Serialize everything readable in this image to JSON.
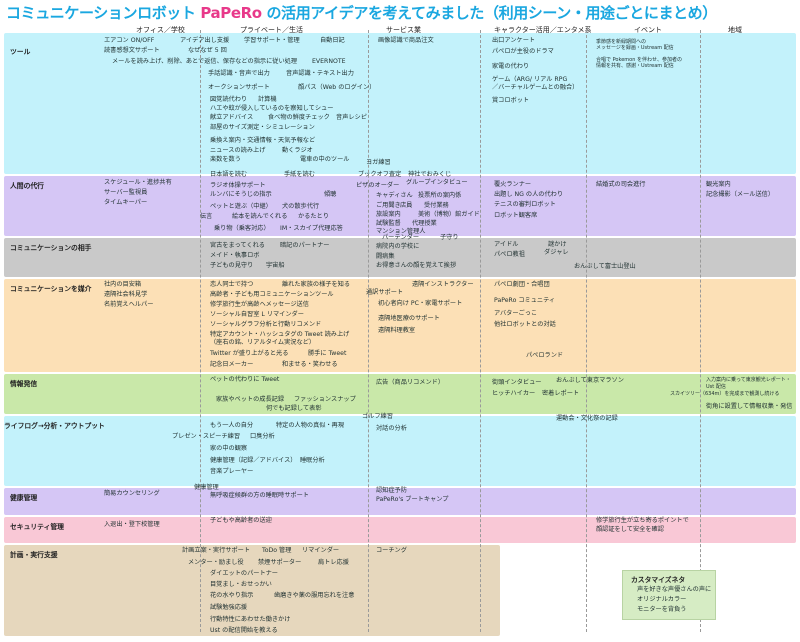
{
  "title_main": "コミュニケーションロボット ",
  "title_brand": "PaPeRo",
  "title_rest": " の活用アイデアを考えてみました（利用シーン・用途ごとにまとめ）",
  "columns": [
    "オフィス／学校",
    "プライベート／生活",
    "サービス業",
    "キャラクター活用／エンタメ系",
    "イベント",
    "地域"
  ],
  "rows": [
    {
      "label": "ツール",
      "color": "#c3f2fb"
    },
    {
      "label": "人間の代行",
      "color": "#d5c6f5"
    },
    {
      "label": "コミュニケーションの相手",
      "color": "#c9c9c9"
    },
    {
      "label": "コミュニケーションを媒介",
      "color": "#fce0b6"
    },
    {
      "label": "情報発信",
      "color": "#c9e8a9"
    },
    {
      "label": "ライフログ→分析・アウトプット",
      "color": "#c3f2fb"
    },
    {
      "label": "健康管理",
      "color": "#d5c6f5"
    },
    {
      "label": "セキュリティ管理",
      "color": "#f9c8d6"
    },
    {
      "label": "計画・実行支援",
      "color": "#e6d7bd"
    }
  ],
  "items": [
    "エアコン ON/OFF",
    "アイデア出し支援",
    "学習サポート・管理",
    "自動日記",
    "画像認識で商品注文",
    "出口アンケート",
    "読書感想文サポート",
    "なぜなぜ 5 回",
    "パペロが主役のドラマ",
    "季節感を新緑期間への",
    "メッセージを録画・Ustream 配信",
    "メールを読み上げ、削除、あとで返信、保存などの指示に従い処理",
    "EVERNOTE",
    "家電の代わり",
    "手話認識・音声で出力",
    "音声認識・テキスト出力",
    "ゲーム（ARG/ リアル RPG",
    "／バーチャルゲームとの融合）",
    "合唱で Pokemon を伴わせ、参加者の",
    "情報を共有、感謝・Ustream 配信",
    "オークションサポート",
    "顔パス（Web のログイン）",
    "賞コロボット",
    "図覚読代わり",
    "計算機",
    "ハエや蚊が侵入しているのを察知してシュー",
    "献立アドバイス",
    "食べ物の鮮度チェック",
    "音声レシピ",
    "部屋のサイズ測定・シミュレーション",
    "乗換え案内・交通情報・天気予報など",
    "ニュースの読み上げ",
    "動くラジオ",
    "楽数を数う",
    "電車の中のツール",
    "ヨガ練習",
    "スケジュール・進捗共有",
    "サーバー監視員",
    "タイムキーパー",
    "日本語を読む",
    "手紙を読む",
    "ブックオフ査定",
    "神社でおみくじ",
    "ラジオ体操サポート",
    "ルンバにそうじの指示",
    "ピザのオーダー",
    "グループインタビュー",
    "覆火ランナー",
    "結婚式の司会進行",
    "観光案内",
    "ペットと遊ぶ（中継）",
    "犬の散歩代行",
    "傾聴",
    "キャディさん",
    "投票所の案内係",
    "出題し NG の人の代わり",
    "記念撮影（メール送信）",
    "絵本を読んでくれる",
    "かるたとり",
    "ご用聞き",
    "店員",
    "受付業務",
    "テニスの審判ロボット",
    "伝言",
    "乗り物（乗客対応）",
    "IM・スカイプ代理応答",
    "旅設案内",
    "美術（博物）館ガイド",
    "ロボット観客席",
    "試験監督",
    "代理授業",
    "マンション管理人",
    "パーテンダー",
    "子守り",
    "宮古をまってくれる",
    "暗記のパートナー",
    "アイドル",
    "謎かけ",
    "メイド・執事ロボ",
    "病院内の学校に",
    "パペロ教祖",
    "ダジャレ",
    "子どもの見守り",
    "宇宙船",
    "闘病集",
    "お得意さんの顔を覚えて挨拶",
    "おんぶして富士山登山",
    "社内の目安箱",
    "恋人同士で持つ",
    "離れた家族の様子を知る",
    "遠隔インストラクター",
    "パペロ劇団・合唱団",
    "遠隔社会科見学",
    "高齢者・子ども用コミュニケーションツール",
    "通訳サポート",
    "名前覚えヘルパー",
    "修学旅行生が高齢ヘメッセージ送信",
    "初心者向け PC・家電サポート",
    "PaPeRo コミュニティ",
    "ソーシャル自習室 L リマインダー",
    "遠隔地医療のサポート",
    "アバターごっこ",
    "ソーシャルグラフ分析と行動リコメンド",
    "他社ロボットとの対話",
    "特定アカウント・ハッシュタグの Tweet 読み上げ",
    "遠隔料理教室",
    "（座右の銘、リアルタイム実況など）",
    "Twitter が盛り上がると光る",
    "勝手に Tweet",
    "パペロランド",
    "記念日メーカー",
    "和ませる・笑わせる",
    "ペットの代わりに Tweet",
    "広告（商品リコメンド）",
    "街頭インタビュー",
    "おんぶして東京マラソン",
    "入力案内に乗って東京観光レポート・",
    "Ust 配信",
    "ヒッチハイカー",
    "密着レポート",
    "スカイツリー（634m）を完成まで観測し続ける",
    "家族やペットの成長記録",
    "ファッションスナップ",
    "街角に設置して情報収集・発信",
    "何でも記録して表彰",
    "もう一人の自分",
    "特定の人物の真似・再現",
    "ゴルフ練習",
    "対話の分析",
    "運動会・文化祭の記録",
    "プレゼン・スピーチ練習",
    "口臭分析",
    "家の中の観察",
    "健康管理（記録／アドバイス）",
    "睡眠分析",
    "音楽プレーヤー",
    "簡易カウンセリング",
    "健康管理",
    "無呼吸症候群の方の睡眠時サポート",
    "認知症予防",
    "PaPeRo's ブートキャンプ",
    "入退出・登下校管理",
    "子どもや高齢者の送迎",
    "修学旅行生が立ち寄るポイントで",
    "顔認証をして安全を確認",
    "計画立案・実行サポート",
    "ToDo 管理",
    "リマインダー",
    "コーチング",
    "メンター・励まし役",
    "禁煙サポーター",
    "肩トレ応援",
    "ダイエットのパートナー",
    "目覚まし・おせっかい",
    "花の水やり指示",
    "歯磨きや薬の服用忘れを注意",
    "試験勉強応援",
    "行動特性にあわせた働きかけ",
    "Ust の配信開始を教える"
  ],
  "sticky": {
    "title": "カスタマイズネタ",
    "lines": [
      "声を好きな声優さんの声に",
      "オリジナルカラー",
      "モニターを背負う"
    ]
  }
}
